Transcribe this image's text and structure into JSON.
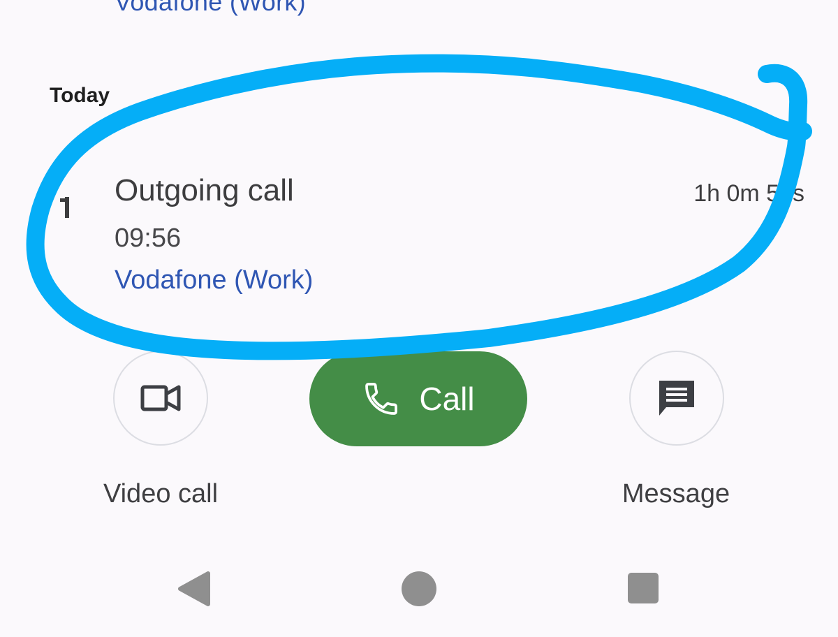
{
  "previous_entry": {
    "carrier": "Vodafone (Work)"
  },
  "section": {
    "label": "Today"
  },
  "call": {
    "type": "Outgoing call",
    "time": "09:56",
    "carrier": "Vodafone (Work)",
    "duration": "1h 0m 50s"
  },
  "actions": {
    "video_label": "Video call",
    "call_label": "Call",
    "message_label": "Message",
    "video_icon": "video-camera-icon",
    "call_icon": "phone-icon",
    "message_icon": "chat-message-icon"
  },
  "navigation": {
    "back_icon": "back-triangle-icon",
    "home_icon": "home-circle-icon",
    "recents_icon": "recents-square-icon"
  },
  "colors": {
    "background": "#fbf9fc",
    "accent_link": "#2f56b3",
    "call_button": "#448d47",
    "annotation": "#05aef7"
  }
}
